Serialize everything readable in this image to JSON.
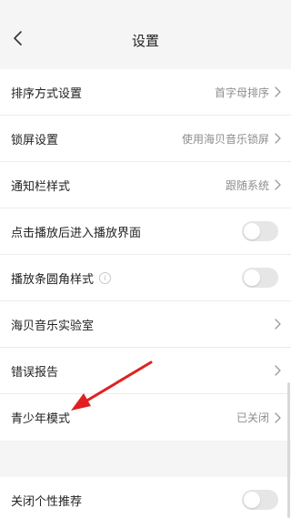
{
  "header": {
    "title": "设置",
    "back_icon": "chevron-left-icon"
  },
  "settings": {
    "sort_order": {
      "label": "排序方式设置",
      "value": "首字母排序"
    },
    "lock_screen": {
      "label": "锁屏设置",
      "value": "使用海贝音乐锁屏"
    },
    "notification_style": {
      "label": "通知栏样式",
      "value": "跟随系统"
    },
    "enter_playback": {
      "label": "点击播放后进入播放界面",
      "toggle_on": false
    },
    "playbar_rounded": {
      "label": "播放条圆角样式",
      "toggle_on": false,
      "info_icon": "info-icon"
    },
    "lab": {
      "label": "海贝音乐实验室"
    },
    "error_report": {
      "label": "错误报告"
    },
    "teen_mode": {
      "label": "青少年模式",
      "value": "已关闭"
    },
    "personalized_rec": {
      "label": "关闭个性推荐",
      "toggle_on": false
    }
  },
  "colors": {
    "annotation_arrow": "#e02020",
    "toggle_off": "#e6e6e6"
  }
}
